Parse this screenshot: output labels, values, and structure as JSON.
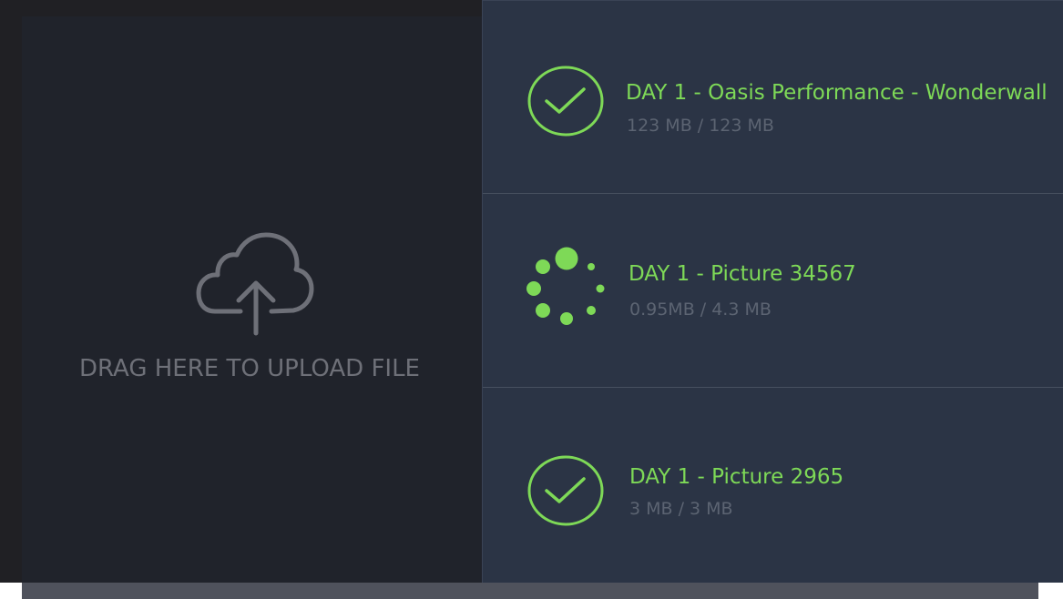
{
  "dropzone": {
    "label": "DRAG HERE TO UPLOAD FILE",
    "icon": "cloud-upload-icon"
  },
  "uploads": [
    {
      "title": "DAY 1 - Oasis Performance - Wonderwall",
      "size": "123 MB / 123 MB",
      "status": "complete",
      "icon": "check-circle-icon"
    },
    {
      "title": "DAY 1 - Picture 34567",
      "size": "0.95MB / 4.3 MB",
      "status": "uploading",
      "icon": "spinner-icon"
    },
    {
      "title": "DAY 1 - Picture 2965",
      "size": "3 MB / 3 MB",
      "status": "complete",
      "icon": "check-circle-icon"
    }
  ],
  "colors": {
    "accent_green": "#7ed957",
    "icon_gray": "#6e7078",
    "panel_bg": "#2b3445",
    "dropzone_bg": "#20232b"
  }
}
